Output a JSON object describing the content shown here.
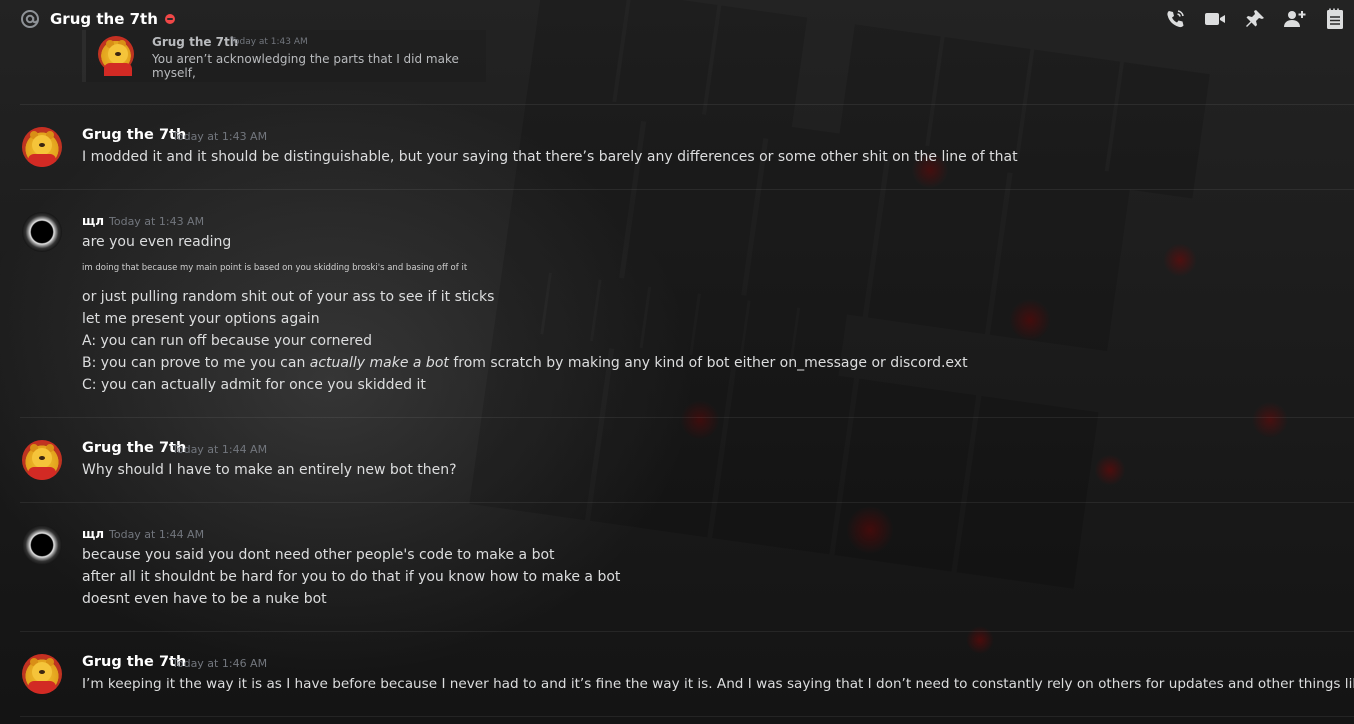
{
  "header": {
    "channel_title": "Grug the 7th",
    "status": "do-not-disturb",
    "actions": [
      "phone-call-icon",
      "video-call-icon",
      "pin-icon",
      "add-member-icon",
      "notes-icon"
    ]
  },
  "reply_preview": {
    "author": "Grug the 7th",
    "timestamp": "Today at 1:43 AM",
    "text": "You aren’t acknowledging the parts that I did make myself,"
  },
  "messages": [
    {
      "author": "Grug the 7th",
      "timestamp": "Today at 1:43 AM",
      "avatar": "winnie-the-pooh",
      "lines": [
        "I modded it and it should be distinguishable, but your saying that there’s barely any differences or some other shit on the line of that"
      ]
    },
    {
      "author": "щл",
      "timestamp": "Today at 1:43 AM",
      "avatar": "eclipse",
      "lines": [
        "are you even reading",
        "im doing that because my main point is based on you skidding broski's and basing off of it",
        "or just pulling random shit out of your ass to see if it sticks",
        "let me present your options again",
        "A: you can run off because your cornered",
        "B: you can prove to me you can ",
        "actually make a bot",
        " from scratch by making any kind of bot either on_message or discord.ext",
        "C: you can actually admit for once you skidded it"
      ]
    },
    {
      "author": "Grug the 7th",
      "timestamp": "Today at 1:44 AM",
      "avatar": "winnie-the-pooh",
      "lines": [
        "Why should I have to make an entirely new bot then?"
      ]
    },
    {
      "author": "щл",
      "timestamp": "Today at 1:44 AM",
      "avatar": "eclipse",
      "lines": [
        "because you said you dont need other people's code to make a bot",
        "after all it shouldnt be hard for you to do that if you know how to make a bot",
        "doesnt even have to be a nuke bot"
      ]
    },
    {
      "author": "Grug the 7th",
      "timestamp": "Today at 1:46 AM",
      "avatar": "winnie-the-pooh",
      "lines": [
        "I’m keeping it the way it is as I have before because I never had to and it’s fine the way it is. And I was saying that I don’t need to constantly rely on others for updates and other things like that"
      ]
    }
  ],
  "colors": {
    "accent_dnd": "#f04747",
    "author": "#ffffff",
    "text": "#dcddde",
    "timestamp": "#72767d"
  }
}
